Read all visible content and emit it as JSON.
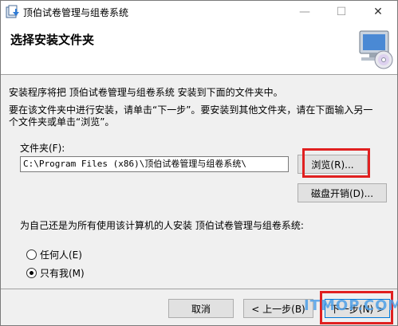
{
  "window": {
    "title": "顶伯试卷管理与组卷系统",
    "controls": {
      "minimize": "—",
      "maximize": "☐",
      "close": "✕"
    }
  },
  "header": {
    "title": "选择安装文件夹"
  },
  "body": {
    "intro": "安装程序将把 顶伯试卷管理与组卷系统 安装到下面的文件夹中。",
    "instructions_line1": "要在该文件夹中进行安装，请单击“下一步”。要安装到其他文件夹，请在下面输入另一",
    "instructions_line2": "个文件夹或单击“浏览”。"
  },
  "folder": {
    "label": "文件夹(F):",
    "value": "C:\\Program Files (x86)\\顶伯试卷管理与组卷系统\\"
  },
  "buttons": {
    "browse": "浏览(R)...",
    "disk_cost": "磁盘开销(D)...",
    "cancel": "取消",
    "back": "< 上一步(B)",
    "next": "下一步(N) >"
  },
  "scope": {
    "question": "为自己还是为所有使用该计算机的人安装 顶伯试卷管理与组卷系统:",
    "options": [
      {
        "label": "任何人(E)",
        "selected": false
      },
      {
        "label": "只有我(M)",
        "selected": true
      }
    ]
  },
  "watermark": "ITMOP.COM",
  "colors": {
    "highlight": "#e02020",
    "watermark": "#4ea0e8"
  }
}
